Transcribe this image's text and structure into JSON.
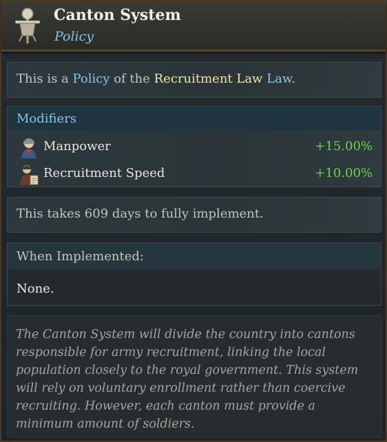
{
  "header": {
    "title": "Canton System",
    "subtitle": "Policy",
    "icon": "scarecrow-policy-icon"
  },
  "law_info": {
    "prefix": "This is a ",
    "type": "Policy",
    "middle": " of the ",
    "law_name": "Recruitment Law",
    "law_suffix": " Law",
    "end": "."
  },
  "modifiers": {
    "title": "Modifiers",
    "items": [
      {
        "icon": "soldier-manpower-icon",
        "name": "Manpower",
        "value": "+15.00%"
      },
      {
        "icon": "recruitment-speed-icon",
        "name": "Recruitment Speed",
        "value": "+10.00%"
      }
    ]
  },
  "implementation": {
    "days_text": "This takes 609 days to fully implement."
  },
  "when_implemented": {
    "title": "When Implemented:",
    "value": "None."
  },
  "description": "The Canton System will divide the country into cantons responsible for army recruitment, linking the local population closely to the royal government. This system will rely on voluntary enrollment rather than coercive recruiting. However, each canton must provide a minimum amount of soldiers.",
  "colors": {
    "accent_blue": "#8ec3e6",
    "highlight_yellow": "#f2e3a6",
    "positive_green": "#6fcf52"
  }
}
